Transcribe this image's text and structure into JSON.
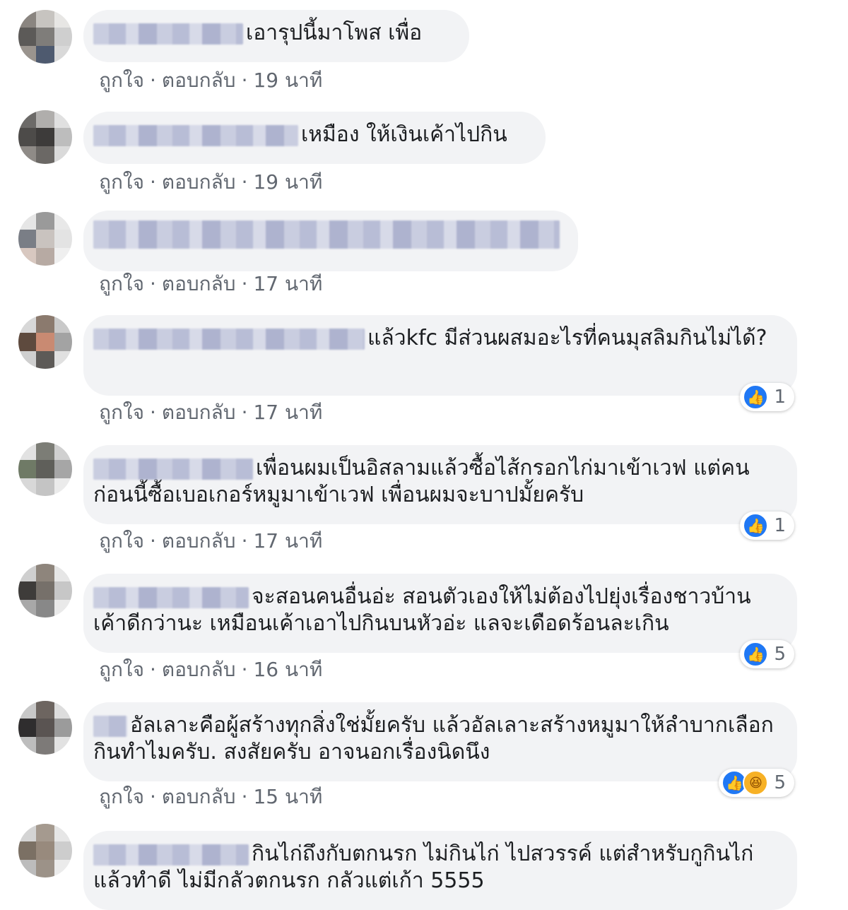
{
  "actions": {
    "like": "ถูกใจ",
    "reply": "ตอบกลับ",
    "separator": "·"
  },
  "icons": {
    "like": "thumbs-up-like-icon",
    "haha": "haha-laugh-icon"
  },
  "colors": {
    "bubble": "#f2f3f5",
    "like_blue": "#2078f4",
    "meta_gray": "#616770"
  },
  "comments": [
    {
      "text": "เอารุปนี้มาโพส เพื่อ",
      "time": "19 นาที"
    },
    {
      "text": "เหมือง ให้เงินเค้าไปกิน",
      "time": "19 นาที"
    },
    {
      "text": "",
      "time": "17 นาที"
    },
    {
      "text": "แล้วkfc มีส่วนผสมอะไรที่คนมุสลิมกินไม่ได้?",
      "time": "17 นาที",
      "reaction_count": "1"
    },
    {
      "text": "เพื่อนผมเป็นอิสลามแล้วซื้อไส้กรอกไก่มาเข้าเวฟ แต่คนก่อนนี้ซื้อเบอเกอร์หมูมาเข้าเวฟ เพื่อนผมจะบาปมั้ยครับ",
      "time": "17 นาที",
      "reaction_count": "1"
    },
    {
      "text": "จะสอนคนอื่นอ่ะ สอนตัวเองให้ไม่ต้องไปยุ่งเรื่องชาวบ้านเค้าดีกว่านะ เหมือนเค้าเอาไปกินบนหัวอ่ะ แลจะเดือดร้อนละเกิน",
      "time": "16 นาที",
      "reaction_count": "5"
    },
    {
      "text": "อัลเลาะคือผู้สร้างทุกสิ่งใช่มั้ยครับ แล้วอัลเลาะสร้างหมูมาให้ลำบากเลือกกินทำไมครับ. สงสัยครับ อาจนอกเรื่องนิดนึง",
      "time": "15 นาที",
      "reaction_count": "5"
    },
    {
      "text": "กินไก่ถึงกับตกนรก ไม่กินไก่ ไปสวรรค์ แต่สำหรับกูกินไก่แล้วทำดี ไม่มีกลัวตกนรก กลัวแต่เก้า 5555"
    }
  ]
}
